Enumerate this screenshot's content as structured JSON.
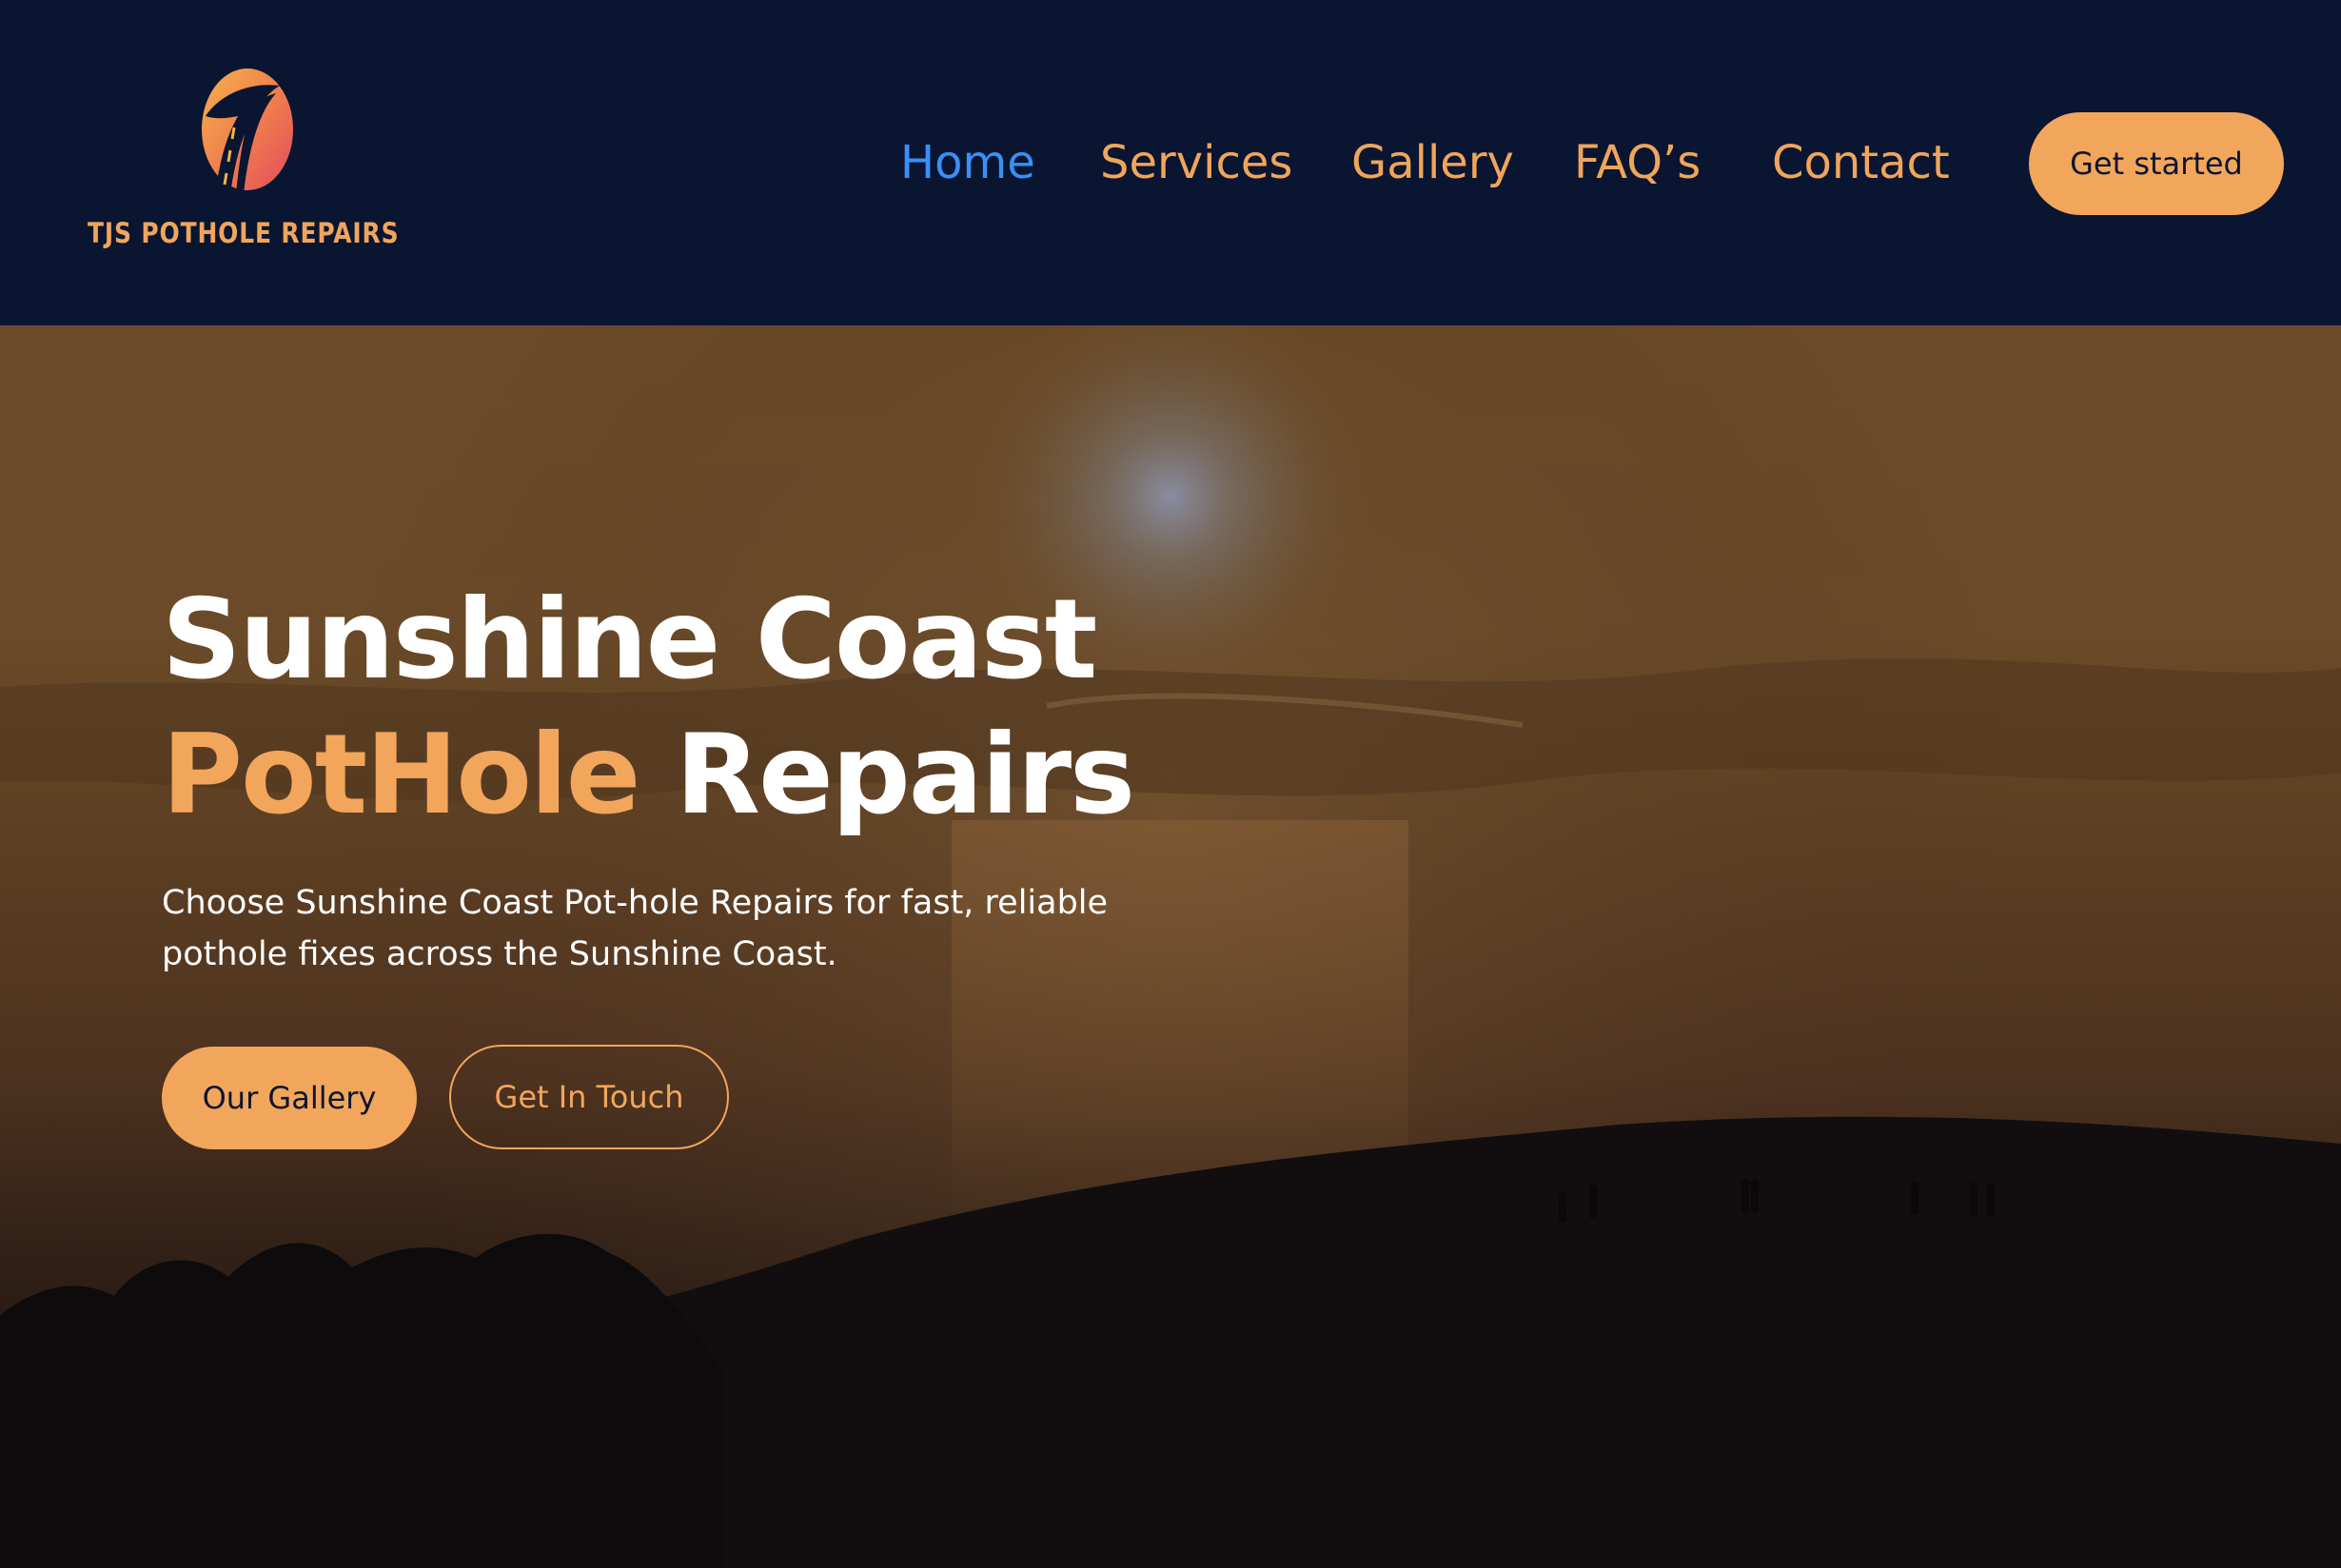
{
  "brand": {
    "name": "TJS POTHOLE REPAIRS",
    "logo_icon": "road-swoosh-logo-icon"
  },
  "nav": {
    "items": [
      {
        "label": "Home",
        "active": true
      },
      {
        "label": "Services",
        "active": false
      },
      {
        "label": "Gallery",
        "active": false
      },
      {
        "label": "FAQ’s",
        "active": false
      },
      {
        "label": "Contact",
        "active": false
      }
    ],
    "cta_label": "Get started"
  },
  "hero": {
    "title_line1": "Sunshine Coast",
    "title_accent": "PotHole",
    "title_rest": "Repairs",
    "subtitle": "Choose Sunshine Coast Pot-hole Repairs for fast, reliable pothole fixes across the Sunshine Coast.",
    "primary_button": "Our Gallery",
    "secondary_button": "Get In Touch"
  },
  "colors": {
    "header_bg": "#0a1631",
    "accent_orange": "#f2a65c",
    "active_nav_blue": "#3b8ff6",
    "text_white": "#ffffff"
  }
}
